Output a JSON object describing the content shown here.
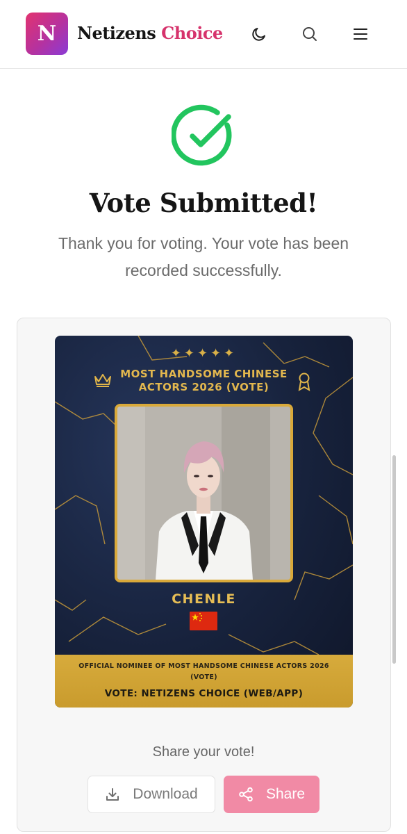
{
  "header": {
    "logo_letter": "N",
    "brand_part1": "Netizens",
    "brand_part2": "Choice",
    "icons": [
      "moon-icon",
      "search-icon",
      "menu-icon"
    ]
  },
  "success": {
    "title": "Vote Submitted!",
    "message": "Thank you for voting. Your vote has been recorded successfully."
  },
  "poster": {
    "sparkles": "✦✦✦✦✦",
    "title": "MOST HANDSOME CHINESE ACTORS 2026 (VOTE)",
    "nominee_name": "CHENLE",
    "country_flag": "china-flag",
    "footer_small": "OFFICIAL NOMINEE OF MOST HANDSOME CHINESE ACTORS 2026 (VOTE)",
    "footer_big": "VOTE: NETIZENS CHOICE (WEB/APP)"
  },
  "share": {
    "label": "Share your vote!",
    "download_label": "Download",
    "share_label": "Share"
  },
  "colors": {
    "brand_pink": "#d6336c",
    "success_green": "#22c55e",
    "poster_gold": "#d9a93a",
    "poster_navy": "#17223c",
    "share_button": "#f18aa5"
  }
}
